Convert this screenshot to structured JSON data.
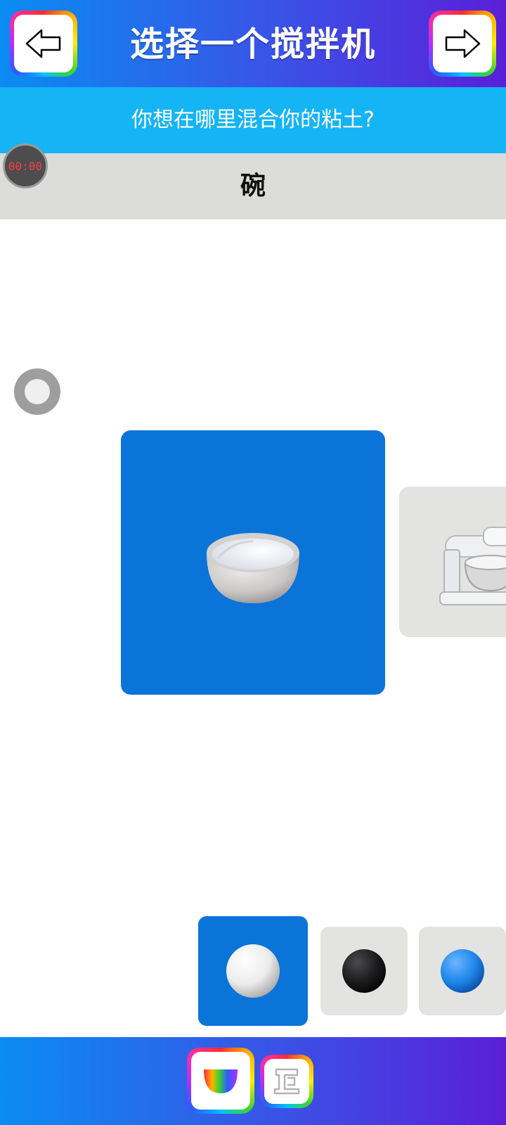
{
  "header": {
    "title": "选择一个搅拌机",
    "back_icon": "arrow-left-icon",
    "next_icon": "arrow-right-icon"
  },
  "prompt": "你想在哪里混合你的粘土?",
  "selected_mixer_name": "碗",
  "timer": "00:00",
  "mixers": [
    {
      "icon": "bowl-icon",
      "selected": true
    },
    {
      "icon": "stand-mixer-icon",
      "selected": false
    }
  ],
  "color_swatches": [
    {
      "color": "#ffffff",
      "selected": true
    },
    {
      "color": "#1c1c1e",
      "selected": false
    },
    {
      "color": "#1f86ea",
      "selected": false
    }
  ],
  "bottom_tabs": [
    {
      "icon": "rainbow-bowl-icon",
      "selected": true
    },
    {
      "icon": "mixer-outline-icon",
      "selected": false
    }
  ],
  "colors": {
    "accent_blue": "#0b74d8",
    "subtitle_bar": "#14b4f5",
    "name_bar": "#dcdcda"
  }
}
